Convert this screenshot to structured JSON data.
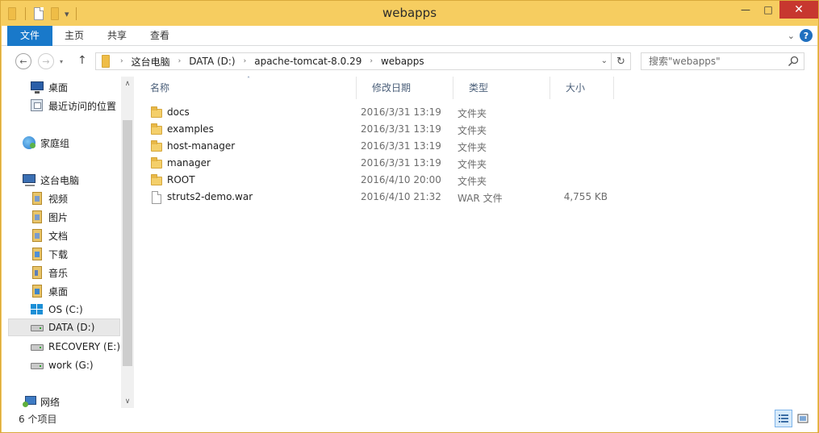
{
  "window": {
    "title": "webapps",
    "minimize": "—",
    "maximize": "□",
    "close": "✕"
  },
  "ribbon": {
    "tabs": [
      "文件",
      "主页",
      "共享",
      "查看"
    ],
    "help": "?"
  },
  "address": {
    "crumbs": [
      "这台电脑",
      "DATA (D:)",
      "apache-tomcat-8.0.29",
      "webapps"
    ],
    "search_placeholder": "搜索\"webapps\""
  },
  "nav": {
    "items": [
      {
        "label": "桌面",
        "icon": "desktop-icon"
      },
      {
        "label": "最近访问的位置",
        "icon": "recent-places-icon"
      },
      {
        "label": "家庭组",
        "icon": "homegroup-icon"
      },
      {
        "label": "这台电脑",
        "icon": "this-pc-icon"
      },
      {
        "label": "视频",
        "icon": "videos-library-icon"
      },
      {
        "label": "图片",
        "icon": "pictures-library-icon"
      },
      {
        "label": "文档",
        "icon": "documents-library-icon"
      },
      {
        "label": "下载",
        "icon": "downloads-library-icon"
      },
      {
        "label": "音乐",
        "icon": "music-library-icon"
      },
      {
        "label": "桌面",
        "icon": "desktop-library-icon"
      },
      {
        "label": "OS (C:)",
        "icon": "windows-drive-icon"
      },
      {
        "label": "DATA (D:)",
        "icon": "drive-icon"
      },
      {
        "label": "RECOVERY (E:)",
        "icon": "drive-icon"
      },
      {
        "label": "work (G:)",
        "icon": "drive-icon"
      },
      {
        "label": "网络",
        "icon": "network-icon"
      }
    ],
    "selected": "DATA (D:)"
  },
  "columns": {
    "name": "名称",
    "modified": "修改日期",
    "type": "类型",
    "size": "大小"
  },
  "files": [
    {
      "name": "docs",
      "modified": "2016/3/31 13:19",
      "type": "文件夹",
      "size": "",
      "icon": "folder-icon"
    },
    {
      "name": "examples",
      "modified": "2016/3/31 13:19",
      "type": "文件夹",
      "size": "",
      "icon": "folder-icon"
    },
    {
      "name": "host-manager",
      "modified": "2016/3/31 13:19",
      "type": "文件夹",
      "size": "",
      "icon": "folder-icon"
    },
    {
      "name": "manager",
      "modified": "2016/3/31 13:19",
      "type": "文件夹",
      "size": "",
      "icon": "folder-icon"
    },
    {
      "name": "ROOT",
      "modified": "2016/4/10 20:00",
      "type": "文件夹",
      "size": "",
      "icon": "folder-icon"
    },
    {
      "name": "struts2-demo.war",
      "modified": "2016/4/10 21:32",
      "type": "WAR 文件",
      "size": "4,755 KB",
      "icon": "file-icon"
    }
  ],
  "status": {
    "count": "6 个项目"
  },
  "colors": {
    "frame": "#f6cd60",
    "accent": "#1979ca",
    "close": "#c7372f"
  }
}
